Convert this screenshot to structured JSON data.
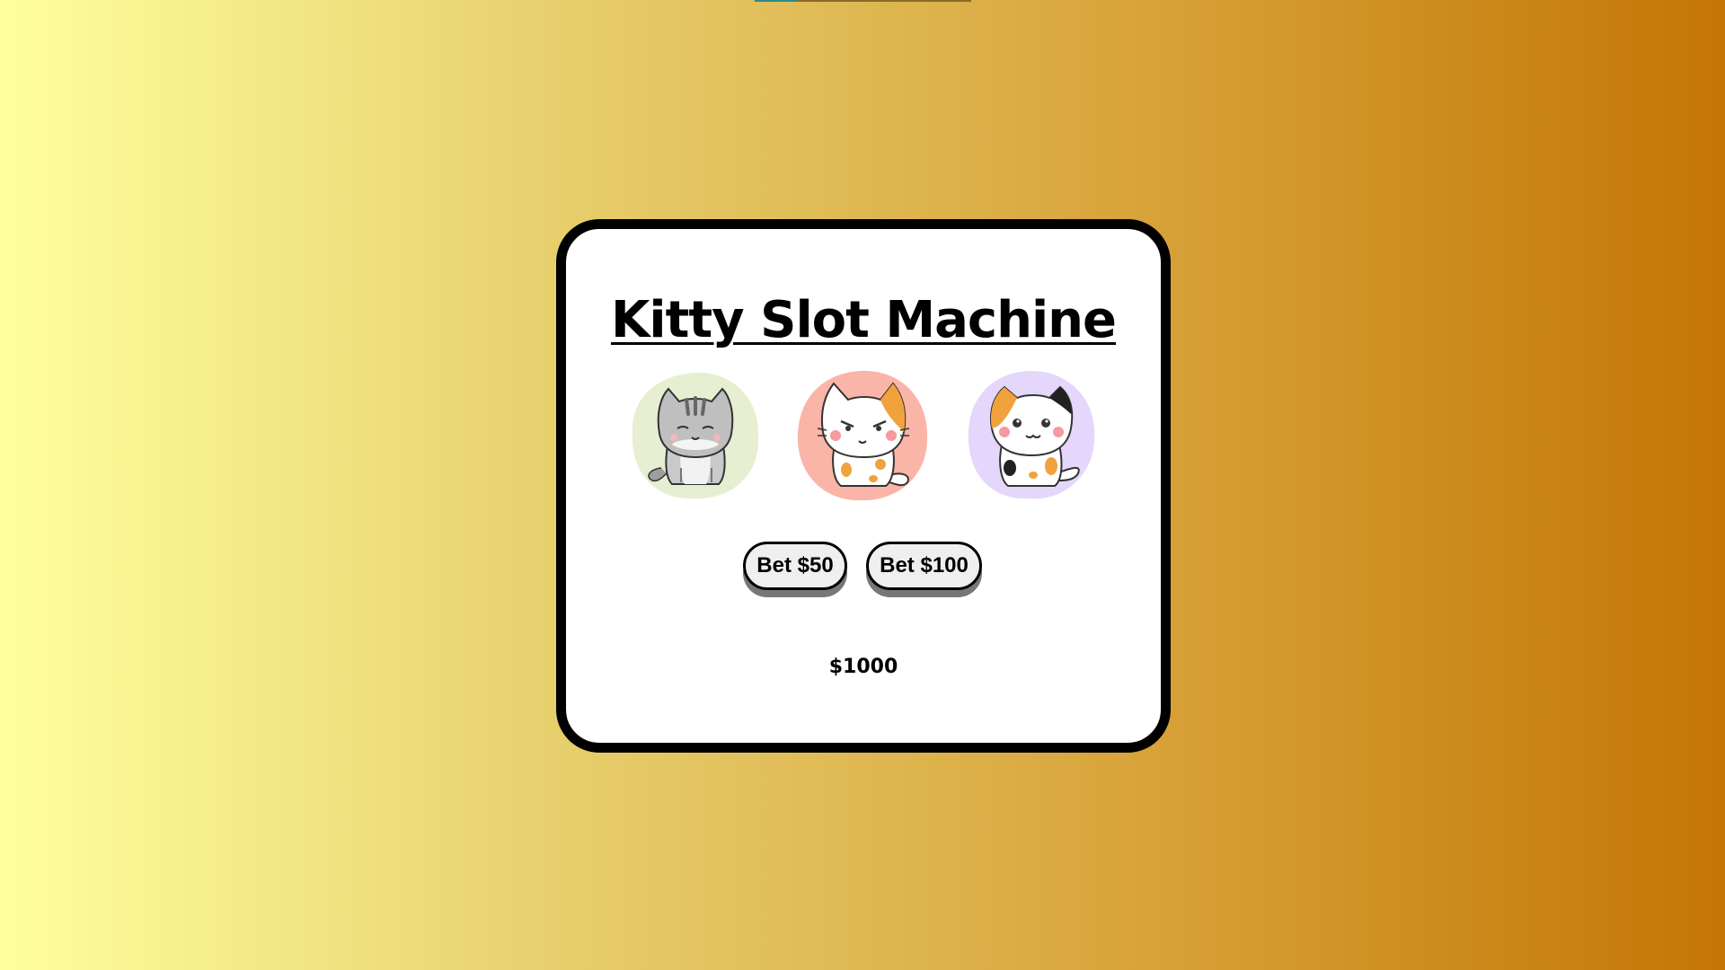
{
  "app": {
    "title": "Kitty Slot Machine"
  },
  "reels": [
    {
      "icon": "gray-tabby-cat-icon",
      "bg_color": "#e6efd1"
    },
    {
      "icon": "calico-cat-grumpy-icon",
      "bg_color": "#fbb4a8"
    },
    {
      "icon": "calico-cat-sitting-icon",
      "bg_color": "#e4d7fb"
    }
  ],
  "buttons": {
    "bet_50_label": "Bet $50",
    "bet_100_label": "Bet $100"
  },
  "balance": "$1000",
  "colors": {
    "gradient_start": "#ffff9e",
    "gradient_end": "#c47604",
    "card_border": "#000000",
    "card_bg": "#ffffff",
    "button_bg": "#efefef",
    "button_shadow": "#777777"
  }
}
